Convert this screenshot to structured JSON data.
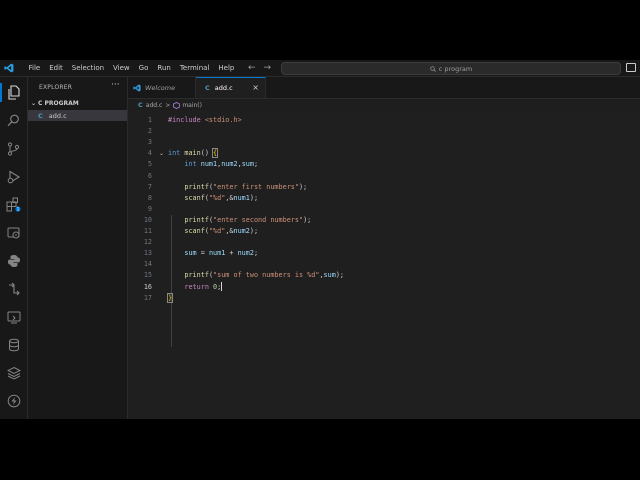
{
  "menu": [
    "File",
    "Edit",
    "Selection",
    "View",
    "Go",
    "Run",
    "Terminal",
    "Help"
  ],
  "search": {
    "text": "c program"
  },
  "sidebar": {
    "header": "EXPLORER",
    "more": "···",
    "folder": "C PROGRAM",
    "files": [
      {
        "icon": "C",
        "name": "add.c"
      }
    ]
  },
  "tabs": [
    {
      "label": "Welcome",
      "icon": "vscode-icon"
    },
    {
      "label": "add.c",
      "icon": "C",
      "close": "×"
    }
  ],
  "breadcrumb": {
    "icon": "C",
    "file": "add.c",
    "sep": ">",
    "symbol": "main()"
  },
  "editor": {
    "current_line": 16,
    "lines": [
      {
        "n": "1",
        "text": "#include <stdio.h>"
      },
      {
        "n": "2",
        "text": ""
      },
      {
        "n": "3",
        "text": ""
      },
      {
        "n": "4",
        "text": "int main() {"
      },
      {
        "n": "5",
        "text": "    int num1,num2,sum;"
      },
      {
        "n": "6",
        "text": ""
      },
      {
        "n": "7",
        "text": "    printf(\"enter first numbers\");"
      },
      {
        "n": "8",
        "text": "    scanf(\"%d\",&num1);"
      },
      {
        "n": "9",
        "text": ""
      },
      {
        "n": "10",
        "text": "    printf(\"enter second numbers\");"
      },
      {
        "n": "11",
        "text": "    scanf(\"%d\",&num2);"
      },
      {
        "n": "12",
        "text": ""
      },
      {
        "n": "13",
        "text": "    sum = num1 + num2;"
      },
      {
        "n": "14",
        "text": ""
      },
      {
        "n": "15",
        "text": "    printf(\"sum of two numbers is %d\",sum);"
      },
      {
        "n": "16",
        "text": "    return 0;"
      },
      {
        "n": "17",
        "text": "}"
      }
    ]
  },
  "colors": {
    "accent": "#0078d4",
    "c_icon": "#519aba"
  }
}
